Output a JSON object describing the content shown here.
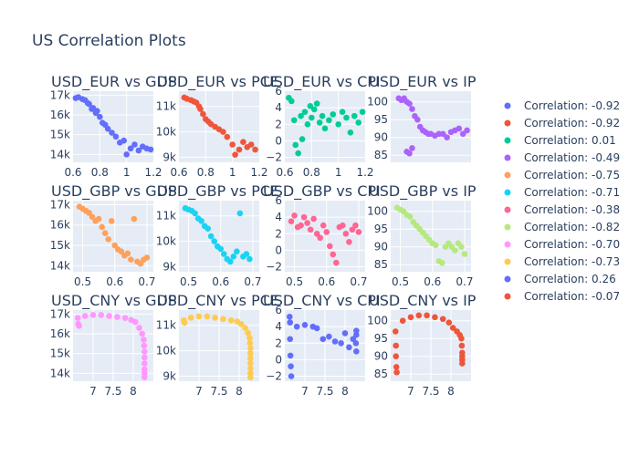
{
  "title": "US Correlation Plots",
  "colors": [
    "#636efa",
    "#ef553b",
    "#00cc96",
    "#ab63fa",
    "#ffa15a",
    "#19d3f3",
    "#ff6692",
    "#b6e880",
    "#ff97ff",
    "#fecb52"
  ],
  "legend_items": [
    {
      "label": "Correlation: -0.92",
      "color": "#636efa"
    },
    {
      "label": "Correlation: -0.92",
      "color": "#ef553b"
    },
    {
      "label": "Correlation: 0.01",
      "color": "#00cc96"
    },
    {
      "label": "Correlation: -0.49",
      "color": "#ab63fa"
    },
    {
      "label": "Correlation: -0.75",
      "color": "#ffa15a"
    },
    {
      "label": "Correlation: -0.71",
      "color": "#19d3f3"
    },
    {
      "label": "Correlation: -0.38",
      "color": "#ff6692"
    },
    {
      "label": "Correlation: -0.82",
      "color": "#b6e880"
    },
    {
      "label": "Correlation: -0.70",
      "color": "#ff97ff"
    },
    {
      "label": "Correlation: -0.73",
      "color": "#fecb52"
    },
    {
      "label": "Correlation: 0.26",
      "color": "#636efa"
    },
    {
      "label": "Correlation: -0.07",
      "color": "#ef553b"
    }
  ],
  "chart_data": [
    {
      "type": "scatter",
      "title": "USD_EUR vs GDP",
      "color": "#636efa",
      "legend": "Correlation: -0.92",
      "xlim": [
        0.6,
        1.2
      ],
      "ylim": [
        13600,
        17200
      ],
      "xticks": [
        0.6,
        0.8,
        1,
        1.2
      ],
      "xtick_labels": [
        "0.6",
        "0.8",
        "1",
        "1.2"
      ],
      "yticks": [
        14000,
        15000,
        16000,
        17000
      ],
      "ytick_labels": [
        "14k",
        "15k",
        "16k",
        "17k"
      ],
      "x": [
        0.62,
        0.64,
        0.67,
        0.69,
        0.71,
        0.72,
        0.74,
        0.75,
        0.77,
        0.78,
        0.8,
        0.82,
        0.84,
        0.86,
        0.89,
        0.92,
        0.95,
        0.98,
        1.0,
        1.03,
        1.06,
        1.09,
        1.12,
        1.15,
        1.18
      ],
      "y": [
        16850,
        16900,
        16800,
        16750,
        16600,
        16550,
        16300,
        16350,
        16100,
        16200,
        15900,
        15600,
        15500,
        15300,
        15100,
        14900,
        14600,
        14700,
        14000,
        14300,
        14500,
        14200,
        14400,
        14300,
        14250
      ]
    },
    {
      "type": "scatter",
      "title": "USD_EUR vs PCE",
      "color": "#ef553b",
      "legend": "Correlation: -0.92",
      "xlim": [
        0.6,
        1.2
      ],
      "ylim": [
        8800,
        11600
      ],
      "xticks": [
        0.6,
        0.8,
        1,
        1.2
      ],
      "xtick_labels": [
        "0.6",
        "0.8",
        "1",
        "1.2"
      ],
      "yticks": [
        9000,
        10000,
        11000
      ],
      "ytick_labels": [
        "9k",
        "10k",
        "11k"
      ],
      "x": [
        0.64,
        0.66,
        0.69,
        0.71,
        0.73,
        0.75,
        0.76,
        0.78,
        0.8,
        0.82,
        0.84,
        0.87,
        0.9,
        0.93,
        0.96,
        1.0,
        1.02,
        1.05,
        1.08,
        1.11,
        1.14,
        1.17
      ],
      "y": [
        11350,
        11300,
        11250,
        11200,
        11150,
        11000,
        10900,
        10700,
        10500,
        10400,
        10300,
        10200,
        10100,
        10000,
        9800,
        9500,
        9100,
        9300,
        9600,
        9400,
        9500,
        9300
      ]
    },
    {
      "type": "scatter",
      "title": "USD_EUR vs CPI",
      "color": "#00cc96",
      "legend": "Correlation: 0.01",
      "xlim": [
        0.6,
        1.2
      ],
      "ylim": [
        -2.6,
        6
      ],
      "xticks": [
        0.6,
        0.8,
        1,
        1.2
      ],
      "xtick_labels": [
        "0.6",
        "0.8",
        "1",
        "1.2"
      ],
      "yticks": [
        -2,
        0,
        2,
        4,
        6
      ],
      "ytick_labels": [
        "−2",
        "0",
        "2",
        "4",
        "6"
      ],
      "x": [
        0.63,
        0.65,
        0.67,
        0.68,
        0.7,
        0.72,
        0.73,
        0.75,
        0.77,
        0.79,
        0.8,
        0.82,
        0.84,
        0.86,
        0.88,
        0.9,
        0.93,
        0.96,
        1.0,
        1.03,
        1.06,
        1.09,
        1.12,
        1.15,
        1.18
      ],
      "y": [
        5.2,
        4.8,
        2.5,
        -0.5,
        -1.5,
        3.0,
        0.2,
        3.5,
        2.0,
        4.2,
        2.8,
        3.8,
        4.5,
        2.2,
        3.0,
        1.5,
        2.5,
        3.2,
        2.0,
        3.5,
        2.8,
        1.0,
        3.0,
        2.2,
        3.5
      ]
    },
    {
      "type": "scatter",
      "title": "USD_EUR vs IP",
      "color": "#ab63fa",
      "legend": "Correlation: -0.49",
      "xlim": [
        0.6,
        1.2
      ],
      "ylim": [
        83,
        103
      ],
      "xticks": [],
      "xtick_labels": [],
      "yticks": [
        85,
        90,
        95,
        100
      ],
      "ytick_labels": [
        "85",
        "90",
        "95",
        "100"
      ],
      "x": [
        0.66,
        0.68,
        0.7,
        0.72,
        0.74,
        0.76,
        0.78,
        0.8,
        0.82,
        0.84,
        0.86,
        0.88,
        0.9,
        0.93,
        0.96,
        0.99,
        1.02,
        1.05,
        1.08,
        1.11,
        1.14,
        1.17,
        0.72,
        0.74,
        0.76
      ],
      "y": [
        101,
        100.5,
        101,
        100,
        99.5,
        98,
        96,
        95,
        93,
        92,
        91.5,
        91,
        91,
        90.5,
        91,
        91,
        90,
        91.5,
        92,
        92.5,
        91,
        92,
        86,
        85.5,
        87
      ]
    },
    {
      "type": "scatter",
      "title": "USD_GBP vs GDP",
      "color": "#ffa15a",
      "legend": "Correlation: -0.75",
      "xlim": [
        0.47,
        0.72
      ],
      "ylim": [
        13700,
        17200
      ],
      "xticks": [
        0.5,
        0.6,
        0.7
      ],
      "xtick_labels": [
        "0.5",
        "0.6",
        "0.7"
      ],
      "yticks": [
        14000,
        15000,
        16000,
        17000
      ],
      "ytick_labels": [
        "14k",
        "15k",
        "16k",
        "17k"
      ],
      "x": [
        0.49,
        0.5,
        0.51,
        0.52,
        0.53,
        0.54,
        0.55,
        0.56,
        0.57,
        0.58,
        0.59,
        0.6,
        0.61,
        0.62,
        0.63,
        0.64,
        0.65,
        0.66,
        0.67,
        0.68,
        0.69,
        0.7
      ],
      "y": [
        16900,
        16800,
        16700,
        16600,
        16400,
        16200,
        16300,
        15900,
        15600,
        15300,
        16200,
        15000,
        14800,
        14700,
        14500,
        14600,
        14300,
        16300,
        14200,
        14100,
        14300,
        14400
      ]
    },
    {
      "type": "scatter",
      "title": "USD_GBP vs PCE",
      "color": "#19d3f3",
      "legend": "Correlation: -0.71",
      "xlim": [
        0.47,
        0.72
      ],
      "ylim": [
        8800,
        11600
      ],
      "xticks": [
        0.5,
        0.6,
        0.7
      ],
      "xtick_labels": [
        "0.5",
        "0.6",
        "0.7"
      ],
      "yticks": [
        9000,
        10000,
        11000
      ],
      "ytick_labels": [
        "9k",
        "10k",
        "11k"
      ],
      "x": [
        0.49,
        0.5,
        0.51,
        0.52,
        0.53,
        0.54,
        0.55,
        0.56,
        0.57,
        0.58,
        0.59,
        0.6,
        0.61,
        0.62,
        0.63,
        0.64,
        0.65,
        0.66,
        0.67,
        0.68,
        0.69
      ],
      "y": [
        11300,
        11250,
        11200,
        11100,
        10900,
        10800,
        10600,
        10500,
        10200,
        10000,
        9800,
        9700,
        9500,
        9300,
        9200,
        9400,
        9600,
        11100,
        9400,
        9500,
        9300
      ]
    },
    {
      "type": "scatter",
      "title": "USD_GBP vs CPI",
      "color": "#ff6692",
      "legend": "Correlation: -0.38",
      "xlim": [
        0.47,
        0.72
      ],
      "ylim": [
        -2.6,
        6
      ],
      "xticks": [
        0.5,
        0.6,
        0.7
      ],
      "xtick_labels": [
        "0.5",
        "0.6",
        "0.7"
      ],
      "yticks": [
        -2,
        0,
        2,
        4,
        6
      ],
      "ytick_labels": [
        "−2",
        "0",
        "2",
        "4",
        "6"
      ],
      "x": [
        0.49,
        0.5,
        0.51,
        0.52,
        0.53,
        0.54,
        0.55,
        0.56,
        0.57,
        0.58,
        0.59,
        0.6,
        0.61,
        0.62,
        0.63,
        0.64,
        0.65,
        0.66,
        0.67,
        0.68,
        0.69,
        0.7
      ],
      "y": [
        3.5,
        4.2,
        2.8,
        3.0,
        4.0,
        3.3,
        2.5,
        3.8,
        2.0,
        1.5,
        3.0,
        2.2,
        0.5,
        -0.5,
        -1.5,
        2.8,
        3.0,
        2.0,
        1.0,
        2.5,
        3.0,
        2.2
      ]
    },
    {
      "type": "scatter",
      "title": "USD_GBP vs IP",
      "color": "#b6e880",
      "legend": "Correlation: -0.82",
      "xlim": [
        0.47,
        0.72
      ],
      "ylim": [
        83,
        103
      ],
      "xticks": [
        0.5,
        0.6,
        0.7
      ],
      "xtick_labels": [
        "0.5",
        "0.6",
        "0.7"
      ],
      "yticks": [
        85,
        90,
        95,
        100
      ],
      "ytick_labels": [
        "85",
        "90",
        "95",
        "100"
      ],
      "x": [
        0.49,
        0.5,
        0.51,
        0.52,
        0.53,
        0.54,
        0.55,
        0.56,
        0.57,
        0.58,
        0.59,
        0.6,
        0.61,
        0.62,
        0.63,
        0.64,
        0.65,
        0.66,
        0.67,
        0.68,
        0.69,
        0.7
      ],
      "y": [
        101,
        100.5,
        100,
        99,
        98.5,
        97,
        96,
        95,
        94,
        93,
        92,
        91,
        90.5,
        86,
        85.5,
        90,
        91,
        90,
        89,
        91,
        90,
        88
      ]
    },
    {
      "type": "scatter",
      "title": "USD_CNY vs GDP",
      "color": "#ff97ff",
      "legend": "Correlation: -0.70",
      "xlim": [
        6.5,
        8.5
      ],
      "ylim": [
        13600,
        17200
      ],
      "xticks": [
        7,
        7.5,
        8
      ],
      "xtick_labels": [
        "7",
        "7.5",
        "8"
      ],
      "yticks": [
        14000,
        15000,
        16000,
        17000
      ],
      "ytick_labels": [
        "14k",
        "15k",
        "16k",
        "17k"
      ],
      "x": [
        6.62,
        6.63,
        6.65,
        6.8,
        7.0,
        7.2,
        7.4,
        7.6,
        7.8,
        7.95,
        8.05,
        8.15,
        8.22,
        8.26,
        8.27,
        8.28,
        8.28,
        8.28,
        8.28,
        8.28,
        8.28
      ],
      "y": [
        16800,
        16500,
        16400,
        16900,
        16950,
        16950,
        16900,
        16850,
        16800,
        16700,
        16600,
        16300,
        16000,
        15700,
        15400,
        15100,
        14800,
        14500,
        14200,
        14000,
        13800
      ]
    },
    {
      "type": "scatter",
      "title": "USD_CNY vs PCE",
      "color": "#fecb52",
      "legend": "Correlation: -0.73",
      "xlim": [
        6.5,
        8.5
      ],
      "ylim": [
        8800,
        11600
      ],
      "xticks": [
        7,
        7.5,
        8
      ],
      "xtick_labels": [
        "7",
        "7.5",
        "8"
      ],
      "yticks": [
        9000,
        10000,
        11000
      ],
      "ytick_labels": [
        "9k",
        "10k",
        "11k"
      ],
      "x": [
        6.62,
        6.64,
        6.8,
        7.0,
        7.2,
        7.4,
        7.6,
        7.8,
        7.95,
        8.05,
        8.15,
        8.22,
        8.26,
        8.27,
        8.28,
        8.28,
        8.28,
        8.28,
        8.28,
        8.28,
        8.28
      ],
      "y": [
        11200,
        11100,
        11300,
        11350,
        11350,
        11300,
        11250,
        11200,
        11150,
        11050,
        10900,
        10700,
        10500,
        10300,
        10100,
        9900,
        9700,
        9500,
        9300,
        9100,
        8950
      ]
    },
    {
      "type": "scatter",
      "title": "USD_CNY vs CPI",
      "color": "#636efa",
      "legend": "Correlation: 0.26",
      "xlim": [
        6.5,
        8.5
      ],
      "ylim": [
        -2.6,
        6
      ],
      "xticks": [
        7,
        7.5,
        8
      ],
      "xtick_labels": [
        "7",
        "7.5",
        "8"
      ],
      "yticks": [
        -2,
        0,
        2,
        4,
        6
      ],
      "ytick_labels": [
        "−2",
        "0",
        "2",
        "4",
        "6"
      ],
      "x": [
        6.62,
        6.63,
        6.63,
        6.64,
        6.65,
        6.66,
        6.8,
        7.0,
        7.2,
        7.3,
        7.45,
        7.6,
        7.75,
        7.9,
        8.0,
        8.1,
        8.2,
        8.27,
        8.28,
        8.28,
        8.28
      ],
      "y": [
        5.2,
        4.5,
        2.5,
        0.5,
        -0.8,
        -2.0,
        4.0,
        4.2,
        4.0,
        3.8,
        2.5,
        2.8,
        2.2,
        2.0,
        3.2,
        1.5,
        2.5,
        2.0,
        3.5,
        1.0,
        3.0
      ]
    },
    {
      "type": "scatter",
      "title": "USD_CNY vs IP",
      "color": "#ef553b",
      "legend": "Correlation: -0.07",
      "xlim": [
        6.5,
        8.5
      ],
      "ylim": [
        83,
        103
      ],
      "xticks": [
        7,
        7.5,
        8
      ],
      "xtick_labels": [
        "7",
        "7.5",
        "8"
      ],
      "yticks": [
        85,
        90,
        95,
        100
      ],
      "ytick_labels": [
        "85",
        "90",
        "95",
        "100"
      ],
      "x": [
        6.62,
        6.63,
        6.63,
        6.64,
        6.65,
        6.8,
        7.0,
        7.2,
        7.4,
        7.6,
        7.8,
        7.95,
        8.05,
        8.15,
        8.22,
        8.26,
        8.27,
        8.28,
        8.28,
        8.28,
        8.28
      ],
      "y": [
        97,
        93,
        90,
        87,
        85.5,
        100,
        101,
        101.5,
        101.5,
        101,
        100.5,
        99.5,
        98,
        97,
        96,
        95,
        93,
        91,
        90,
        89,
        88
      ]
    }
  ]
}
